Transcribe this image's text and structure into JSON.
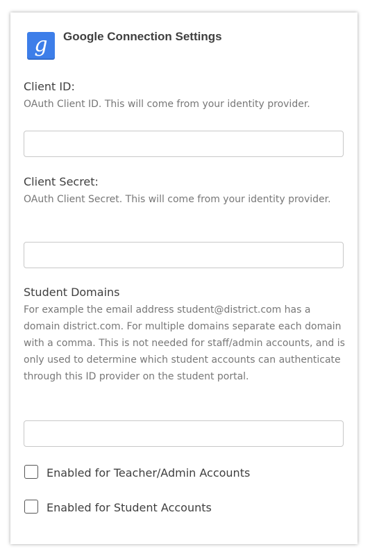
{
  "header": {
    "logo_glyph": "g",
    "title": "Google Connection Settings"
  },
  "fields": {
    "client_id": {
      "label": "Client ID:",
      "description": "OAuth Client ID. This will come from your identity provider.",
      "value": ""
    },
    "client_secret": {
      "label": "Client Secret:",
      "description": "OAuth Client Secret. This will come from your identity provider.",
      "value": ""
    },
    "student_domains": {
      "label": "Student Domains",
      "description": "For example the email address student@district.com has a domain district.com. For multiple domains separate each domain with a comma. This is not needed for staff/admin accounts, and is only used to determine which student accounts can authenticate through this ID provider on the student portal.",
      "value": ""
    }
  },
  "checkboxes": {
    "teacher_admin": {
      "label": "Enabled for Teacher/Admin Accounts",
      "checked": false
    },
    "student": {
      "label": "Enabled for Student Accounts",
      "checked": false
    }
  },
  "colors": {
    "logo_background": "#3d7ee9",
    "text_primary": "#3f3f3f",
    "text_secondary": "#777777",
    "input_border": "#c8c8c8"
  },
  "icons": {
    "logo": "google-g-icon",
    "checkbox": "checkbox-empty-icon"
  }
}
